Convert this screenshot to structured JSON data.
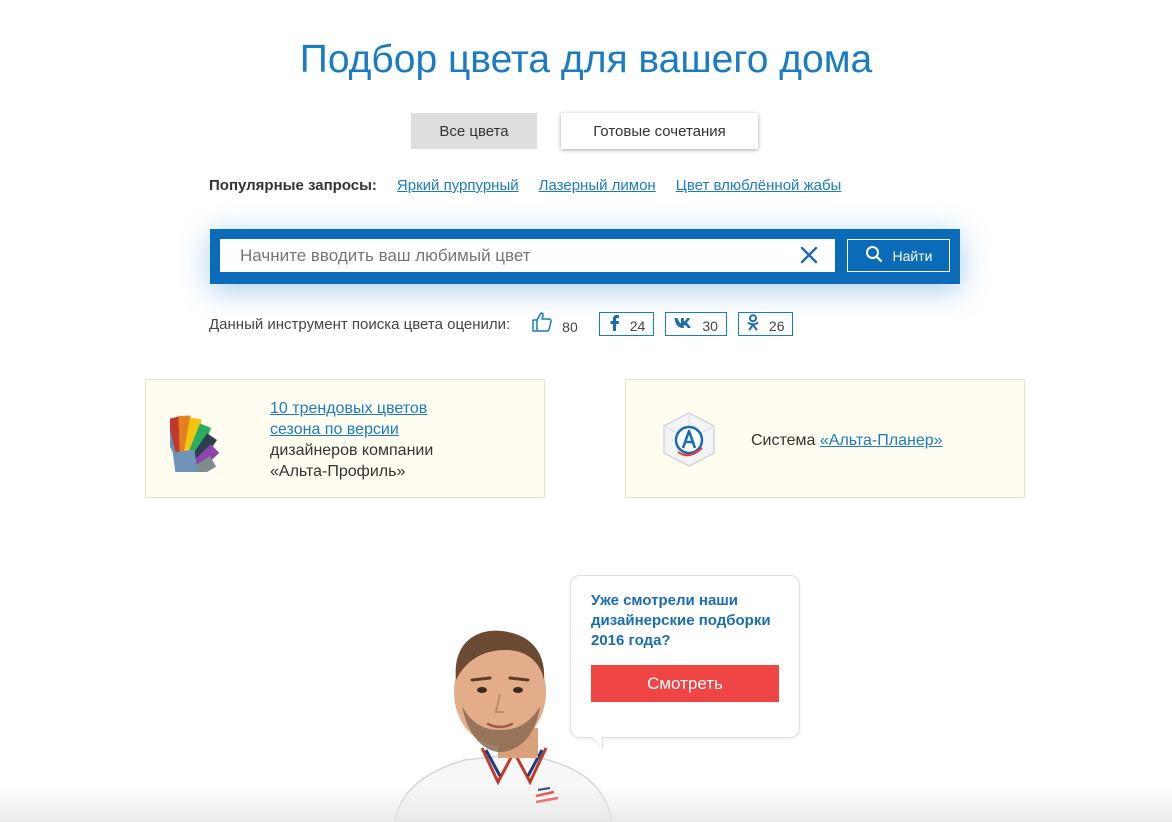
{
  "page": {
    "title": "Подбор цвета для вашего дома"
  },
  "tabs": [
    {
      "label": "Все цвета",
      "active": true
    },
    {
      "label": "Готовые сочетания",
      "active": false
    }
  ],
  "popular": {
    "label": "Популярные запросы:",
    "links": [
      "Яркий пурпурный",
      "Лазерный лимон",
      "Цвет влюблённой жабы"
    ]
  },
  "search": {
    "value": "",
    "placeholder": "Начните вводить ваш любимый цвет",
    "button_label": "Найти"
  },
  "rating": {
    "label": "Данный инструмент поиска цвета оценили:",
    "likes": "80",
    "facebook": "24",
    "vk": "30",
    "ok": "26"
  },
  "cards": {
    "trends": {
      "link": "10 трендовых цветов сезона по версии",
      "text": "дизайнеров компании «Альта-Профиль»"
    },
    "planner": {
      "prefix": "Система",
      "link": "«Альта-Планер»"
    }
  },
  "promo": {
    "text": "Уже смотрели наши дизайнерские подборки 2016 года?",
    "button_label": "Смотреть"
  },
  "colors": {
    "brand_blue": "#1a7bc2",
    "search_bg": "#0a6cb8",
    "cta_red": "#f04545",
    "card_bg": "#fffcf0"
  },
  "icons": [
    "clear-icon",
    "search-icon",
    "thumbs-up-icon",
    "facebook-icon",
    "vk-icon",
    "odnoklassniki-icon",
    "color-fan-icon",
    "alta-planer-cube-icon"
  ]
}
